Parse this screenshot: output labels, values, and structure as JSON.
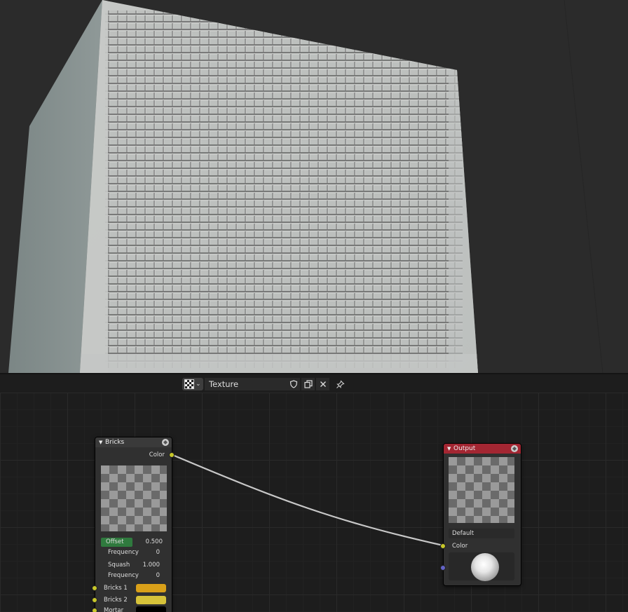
{
  "texture_header": {
    "texture_name": "Texture",
    "icons": [
      "checkerboard-icon",
      "chevron-down-icon",
      "fake-user-shield-icon",
      "duplicate-icon",
      "close-icon",
      "pin-icon"
    ]
  },
  "bricks_node": {
    "title": "Bricks",
    "output_label": "Color",
    "offset_label": "Offset",
    "offset_value": "0.500",
    "offset_freq_label": "Frequency",
    "offset_freq_value": "0",
    "squash_label": "Squash",
    "squash_value": "1.000",
    "squash_freq_label": "Frequency",
    "squash_freq_value": "0",
    "bricks1_label": "Bricks 1",
    "bricks1_color": "#d9a019",
    "bricks2_label": "Bricks 2",
    "bricks2_color": "#d6c23a",
    "mortar_label": "Mortar",
    "mortar_color": "#000000",
    "header_color": "#3a3a3a",
    "offset_field_color": "#2f7a3e"
  },
  "output_node": {
    "title": "Output",
    "default_label": "Default",
    "color_label": "Color",
    "header_color": "#a32632"
  },
  "colors": {
    "socket_yellow": "#c7c729",
    "socket_blue": "#6363c7",
    "link": "#c8c8c8"
  }
}
